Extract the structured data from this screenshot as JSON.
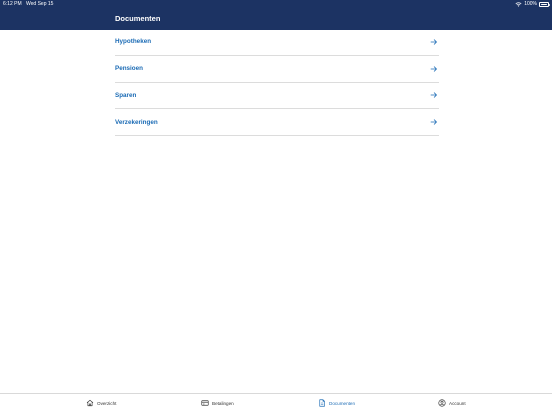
{
  "status": {
    "time": "6:12 PM",
    "date": "Wed Sep 15",
    "battery": "100%"
  },
  "header": {
    "title": "Documenten"
  },
  "documents": [
    {
      "label": "Hypotheken"
    },
    {
      "label": "Pensioen"
    },
    {
      "label": "Sparen"
    },
    {
      "label": "Verzekeringen"
    }
  ],
  "tabs": [
    {
      "label": "Overzicht",
      "icon": "home-icon"
    },
    {
      "label": "Betalingen",
      "icon": "card-icon"
    },
    {
      "label": "Documenten",
      "icon": "document-icon",
      "active": true
    },
    {
      "label": "Account",
      "icon": "user-icon"
    }
  ],
  "colors": {
    "header_bg": "#1c3363",
    "accent": "#1b6bb5"
  }
}
